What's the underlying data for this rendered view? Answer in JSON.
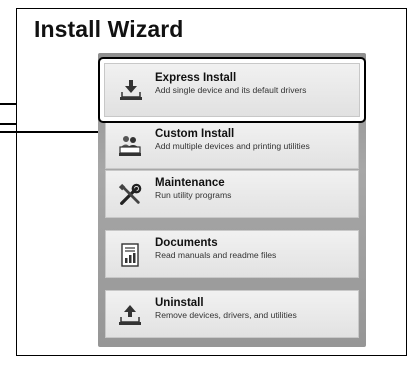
{
  "window": {
    "title": "Install Wizard"
  },
  "menu": [
    {
      "label": "Express Install",
      "description": "Add single device and its default drivers",
      "icon": "download-tray-icon",
      "selected": true
    },
    {
      "label": "Custom Install",
      "description": "Add multiple devices and printing utilities",
      "icon": "people-tray-icon",
      "selected": false
    },
    {
      "label": "Maintenance",
      "description": "Run utility programs",
      "icon": "wrench-screwdriver-icon",
      "selected": false
    },
    {
      "label": "Documents",
      "description": "Read manuals and readme files",
      "icon": "document-chart-icon",
      "selected": false
    },
    {
      "label": "Uninstall",
      "description": "Remove devices, drivers, and utilities",
      "icon": "upload-tray-icon",
      "selected": false
    }
  ],
  "colors": {
    "panel": "#999999",
    "item_bg": "#e8e8e8",
    "border": "#000000"
  }
}
